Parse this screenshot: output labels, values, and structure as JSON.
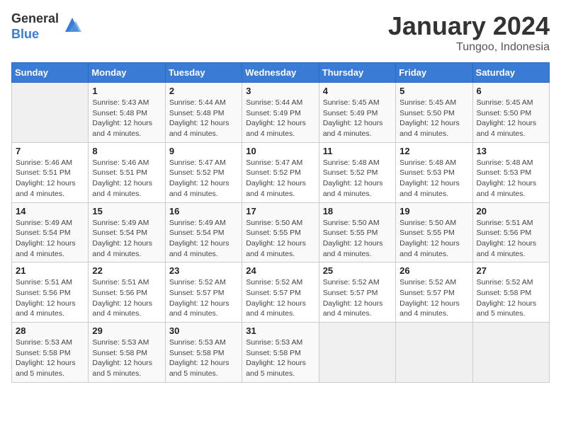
{
  "logo": {
    "general": "General",
    "blue": "Blue"
  },
  "title": "January 2024",
  "subtitle": "Tungoo, Indonesia",
  "days_of_week": [
    "Sunday",
    "Monday",
    "Tuesday",
    "Wednesday",
    "Thursday",
    "Friday",
    "Saturday"
  ],
  "weeks": [
    [
      {
        "day": "",
        "sunrise": "",
        "sunset": "",
        "daylight": ""
      },
      {
        "day": "1",
        "sunrise": "Sunrise: 5:43 AM",
        "sunset": "Sunset: 5:48 PM",
        "daylight": "Daylight: 12 hours and 4 minutes."
      },
      {
        "day": "2",
        "sunrise": "Sunrise: 5:44 AM",
        "sunset": "Sunset: 5:48 PM",
        "daylight": "Daylight: 12 hours and 4 minutes."
      },
      {
        "day": "3",
        "sunrise": "Sunrise: 5:44 AM",
        "sunset": "Sunset: 5:49 PM",
        "daylight": "Daylight: 12 hours and 4 minutes."
      },
      {
        "day": "4",
        "sunrise": "Sunrise: 5:45 AM",
        "sunset": "Sunset: 5:49 PM",
        "daylight": "Daylight: 12 hours and 4 minutes."
      },
      {
        "day": "5",
        "sunrise": "Sunrise: 5:45 AM",
        "sunset": "Sunset: 5:50 PM",
        "daylight": "Daylight: 12 hours and 4 minutes."
      },
      {
        "day": "6",
        "sunrise": "Sunrise: 5:45 AM",
        "sunset": "Sunset: 5:50 PM",
        "daylight": "Daylight: 12 hours and 4 minutes."
      }
    ],
    [
      {
        "day": "7",
        "sunrise": "Sunrise: 5:46 AM",
        "sunset": "Sunset: 5:51 PM",
        "daylight": "Daylight: 12 hours and 4 minutes."
      },
      {
        "day": "8",
        "sunrise": "Sunrise: 5:46 AM",
        "sunset": "Sunset: 5:51 PM",
        "daylight": "Daylight: 12 hours and 4 minutes."
      },
      {
        "day": "9",
        "sunrise": "Sunrise: 5:47 AM",
        "sunset": "Sunset: 5:52 PM",
        "daylight": "Daylight: 12 hours and 4 minutes."
      },
      {
        "day": "10",
        "sunrise": "Sunrise: 5:47 AM",
        "sunset": "Sunset: 5:52 PM",
        "daylight": "Daylight: 12 hours and 4 minutes."
      },
      {
        "day": "11",
        "sunrise": "Sunrise: 5:48 AM",
        "sunset": "Sunset: 5:52 PM",
        "daylight": "Daylight: 12 hours and 4 minutes."
      },
      {
        "day": "12",
        "sunrise": "Sunrise: 5:48 AM",
        "sunset": "Sunset: 5:53 PM",
        "daylight": "Daylight: 12 hours and 4 minutes."
      },
      {
        "day": "13",
        "sunrise": "Sunrise: 5:48 AM",
        "sunset": "Sunset: 5:53 PM",
        "daylight": "Daylight: 12 hours and 4 minutes."
      }
    ],
    [
      {
        "day": "14",
        "sunrise": "Sunrise: 5:49 AM",
        "sunset": "Sunset: 5:54 PM",
        "daylight": "Daylight: 12 hours and 4 minutes."
      },
      {
        "day": "15",
        "sunrise": "Sunrise: 5:49 AM",
        "sunset": "Sunset: 5:54 PM",
        "daylight": "Daylight: 12 hours and 4 minutes."
      },
      {
        "day": "16",
        "sunrise": "Sunrise: 5:49 AM",
        "sunset": "Sunset: 5:54 PM",
        "daylight": "Daylight: 12 hours and 4 minutes."
      },
      {
        "day": "17",
        "sunrise": "Sunrise: 5:50 AM",
        "sunset": "Sunset: 5:55 PM",
        "daylight": "Daylight: 12 hours and 4 minutes."
      },
      {
        "day": "18",
        "sunrise": "Sunrise: 5:50 AM",
        "sunset": "Sunset: 5:55 PM",
        "daylight": "Daylight: 12 hours and 4 minutes."
      },
      {
        "day": "19",
        "sunrise": "Sunrise: 5:50 AM",
        "sunset": "Sunset: 5:55 PM",
        "daylight": "Daylight: 12 hours and 4 minutes."
      },
      {
        "day": "20",
        "sunrise": "Sunrise: 5:51 AM",
        "sunset": "Sunset: 5:56 PM",
        "daylight": "Daylight: 12 hours and 4 minutes."
      }
    ],
    [
      {
        "day": "21",
        "sunrise": "Sunrise: 5:51 AM",
        "sunset": "Sunset: 5:56 PM",
        "daylight": "Daylight: 12 hours and 4 minutes."
      },
      {
        "day": "22",
        "sunrise": "Sunrise: 5:51 AM",
        "sunset": "Sunset: 5:56 PM",
        "daylight": "Daylight: 12 hours and 4 minutes."
      },
      {
        "day": "23",
        "sunrise": "Sunrise: 5:52 AM",
        "sunset": "Sunset: 5:57 PM",
        "daylight": "Daylight: 12 hours and 4 minutes."
      },
      {
        "day": "24",
        "sunrise": "Sunrise: 5:52 AM",
        "sunset": "Sunset: 5:57 PM",
        "daylight": "Daylight: 12 hours and 4 minutes."
      },
      {
        "day": "25",
        "sunrise": "Sunrise: 5:52 AM",
        "sunset": "Sunset: 5:57 PM",
        "daylight": "Daylight: 12 hours and 4 minutes."
      },
      {
        "day": "26",
        "sunrise": "Sunrise: 5:52 AM",
        "sunset": "Sunset: 5:57 PM",
        "daylight": "Daylight: 12 hours and 4 minutes."
      },
      {
        "day": "27",
        "sunrise": "Sunrise: 5:52 AM",
        "sunset": "Sunset: 5:58 PM",
        "daylight": "Daylight: 12 hours and 5 minutes."
      }
    ],
    [
      {
        "day": "28",
        "sunrise": "Sunrise: 5:53 AM",
        "sunset": "Sunset: 5:58 PM",
        "daylight": "Daylight: 12 hours and 5 minutes."
      },
      {
        "day": "29",
        "sunrise": "Sunrise: 5:53 AM",
        "sunset": "Sunset: 5:58 PM",
        "daylight": "Daylight: 12 hours and 5 minutes."
      },
      {
        "day": "30",
        "sunrise": "Sunrise: 5:53 AM",
        "sunset": "Sunset: 5:58 PM",
        "daylight": "Daylight: 12 hours and 5 minutes."
      },
      {
        "day": "31",
        "sunrise": "Sunrise: 5:53 AM",
        "sunset": "Sunset: 5:58 PM",
        "daylight": "Daylight: 12 hours and 5 minutes."
      },
      {
        "day": "",
        "sunrise": "",
        "sunset": "",
        "daylight": ""
      },
      {
        "day": "",
        "sunrise": "",
        "sunset": "",
        "daylight": ""
      },
      {
        "day": "",
        "sunrise": "",
        "sunset": "",
        "daylight": ""
      }
    ]
  ]
}
